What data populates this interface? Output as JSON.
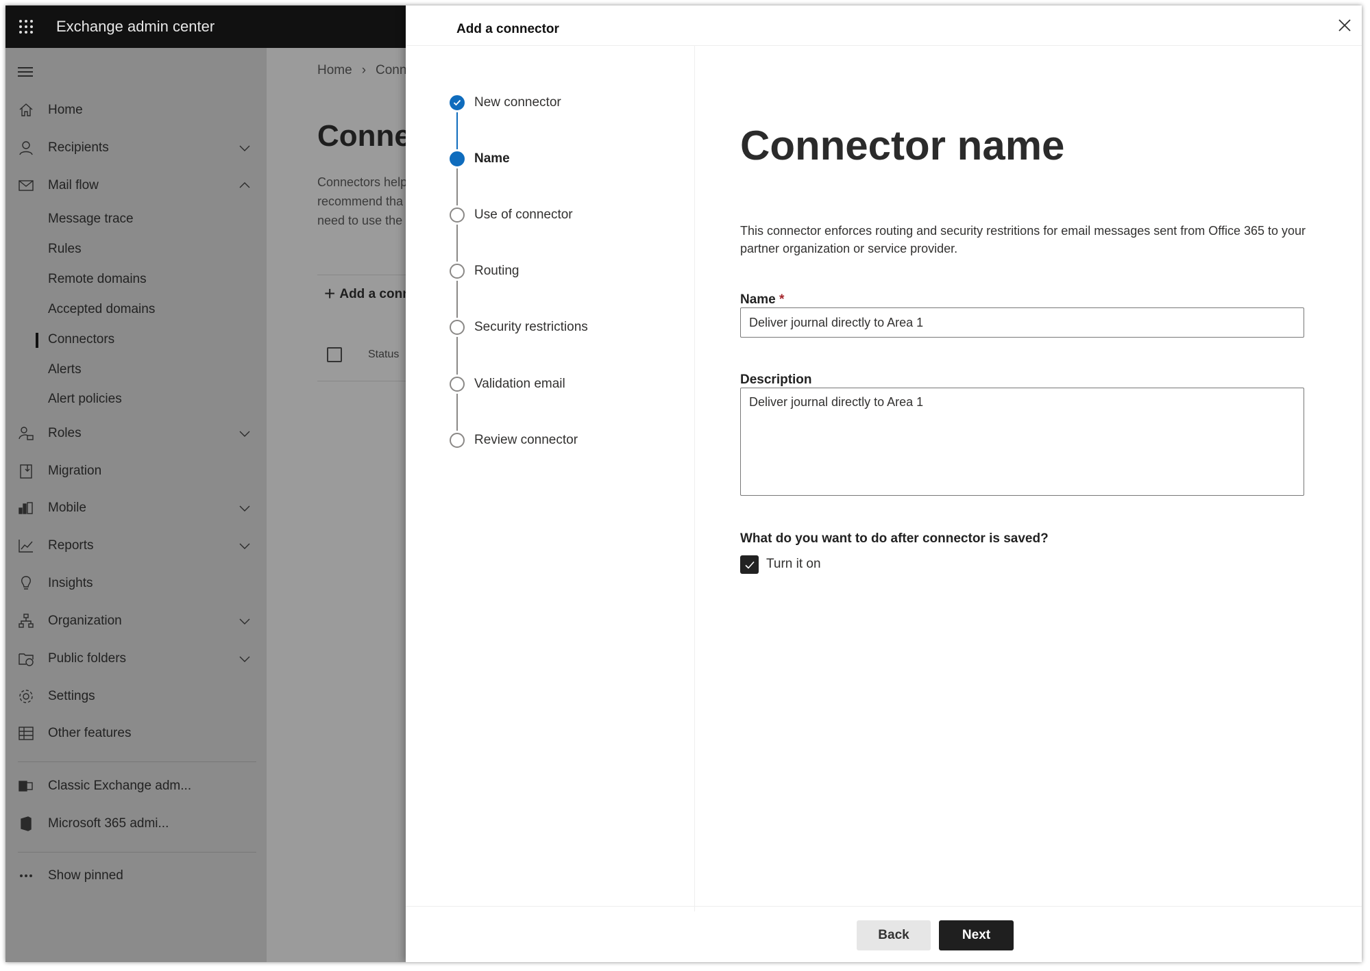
{
  "app": {
    "title": "Exchange admin center"
  },
  "sidebar": {
    "items": [
      {
        "label": "Home",
        "icon": "home-icon"
      },
      {
        "label": "Recipients",
        "icon": "person-icon",
        "expanded": false
      },
      {
        "label": "Mail flow",
        "icon": "mail-icon",
        "expanded": true
      },
      {
        "label": "Message trace"
      },
      {
        "label": "Rules"
      },
      {
        "label": "Remote domains"
      },
      {
        "label": "Accepted domains"
      },
      {
        "label": "Connectors",
        "selected": true
      },
      {
        "label": "Alerts"
      },
      {
        "label": "Alert policies"
      },
      {
        "label": "Roles",
        "icon": "roles-icon",
        "expanded": false
      },
      {
        "label": "Migration",
        "icon": "migration-icon"
      },
      {
        "label": "Mobile",
        "icon": "mobile-icon",
        "expanded": false
      },
      {
        "label": "Reports",
        "icon": "chart-icon",
        "expanded": false
      },
      {
        "label": "Insights",
        "icon": "lightbulb-icon"
      },
      {
        "label": "Organization",
        "icon": "org-icon",
        "expanded": false
      },
      {
        "label": "Public folders",
        "icon": "folder-globe-icon",
        "expanded": false
      },
      {
        "label": "Settings",
        "icon": "gear-icon"
      },
      {
        "label": "Other features",
        "icon": "table-icon"
      },
      {
        "label": "Classic Exchange adm...",
        "icon": "exchange-icon"
      },
      {
        "label": "Microsoft 365 admi...",
        "icon": "office-icon"
      },
      {
        "label": "Show pinned",
        "icon": "more-icon"
      }
    ]
  },
  "main": {
    "breadcrumb": [
      "Home",
      "Conne"
    ],
    "title": "Connec",
    "description": [
      "Connectors help",
      "recommend tha",
      "need to use the"
    ],
    "add_label": "Add a conn",
    "status_col": "Status"
  },
  "panel": {
    "title": "Add a connector",
    "steps": [
      {
        "label": "New connector",
        "state": "done"
      },
      {
        "label": "Name",
        "state": "current"
      },
      {
        "label": "Use of connector",
        "state": "pending"
      },
      {
        "label": "Routing",
        "state": "pending"
      },
      {
        "label": "Security restrictions",
        "state": "pending"
      },
      {
        "label": "Validation email",
        "state": "pending"
      },
      {
        "label": "Review connector",
        "state": "pending"
      }
    ],
    "heading": "Connector name",
    "intro": "This connector enforces routing and security restritions for email messages sent from Office 365 to your partner organization or service provider.",
    "name_label": "Name",
    "required_mark": "*",
    "name_value": "Deliver journal directly to Area 1",
    "description_label": "Description",
    "description_value": "Deliver journal directly to Area 1",
    "question": "What do you want to do after connector is saved?",
    "turn_on_label": "Turn it on",
    "turn_on_checked": true,
    "back_label": "Back",
    "next_label": "Next"
  },
  "colors": {
    "accent": "#0f6cbd",
    "header": "#111111",
    "primary_button": "#1f1f1f"
  }
}
